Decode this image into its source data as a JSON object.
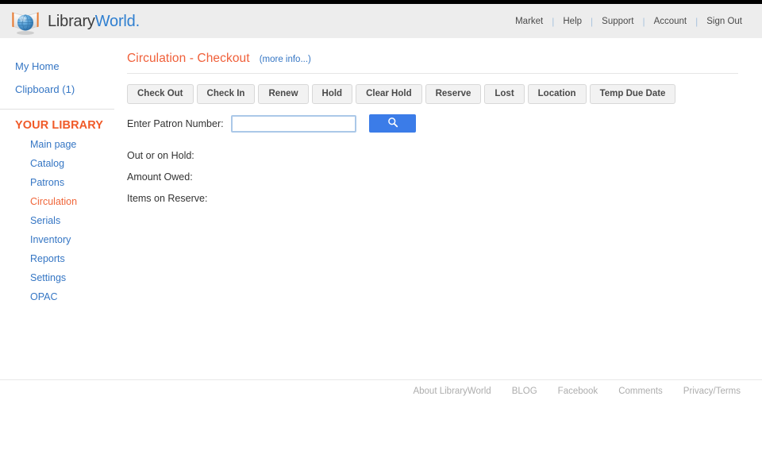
{
  "brand": {
    "name_part1": "Library",
    "name_part2": "World",
    "dot": ".",
    "logo_icon": "globe-book-logo",
    "accent_blue": "#2f7fd0",
    "accent_orange": "#f05a28"
  },
  "topnav": {
    "items": [
      {
        "label": "Market"
      },
      {
        "label": "Help"
      },
      {
        "label": "Support"
      },
      {
        "label": "Account"
      },
      {
        "label": "Sign Out"
      }
    ],
    "separator": "|"
  },
  "sidebar": {
    "top_links": [
      {
        "label": "My Home"
      },
      {
        "label": "Clipboard (1)"
      }
    ],
    "heading": "YOUR LIBRARY",
    "items": [
      {
        "label": "Main page",
        "active": false
      },
      {
        "label": "Catalog",
        "active": false
      },
      {
        "label": "Patrons",
        "active": false
      },
      {
        "label": "Circulation",
        "active": true
      },
      {
        "label": "Serials",
        "active": false
      },
      {
        "label": "Inventory",
        "active": false
      },
      {
        "label": "Reports",
        "active": false
      },
      {
        "label": "Settings",
        "active": false
      },
      {
        "label": "OPAC",
        "active": false
      }
    ]
  },
  "main": {
    "page_title": "Circulation - Checkout",
    "more_info_label": "(more info...)",
    "tabs": [
      {
        "label": "Check Out"
      },
      {
        "label": "Check In"
      },
      {
        "label": "Renew"
      },
      {
        "label": "Hold"
      },
      {
        "label": "Clear Hold"
      },
      {
        "label": "Reserve"
      },
      {
        "label": "Lost"
      },
      {
        "label": "Location"
      },
      {
        "label": "Temp Due Date"
      }
    ],
    "patron": {
      "label": "Enter Patron Number:",
      "value": "",
      "placeholder": "",
      "search_icon": "search-icon"
    },
    "status": [
      {
        "label": "Out or on Hold:",
        "value": ""
      },
      {
        "label": "Amount Owed:",
        "value": ""
      },
      {
        "label": "Items on Reserve:",
        "value": ""
      }
    ]
  },
  "footer": {
    "links": [
      {
        "label": "About LibraryWorld"
      },
      {
        "label": "BLOG"
      },
      {
        "label": "Facebook"
      },
      {
        "label": "Comments"
      },
      {
        "label": "Privacy/Terms"
      }
    ]
  }
}
